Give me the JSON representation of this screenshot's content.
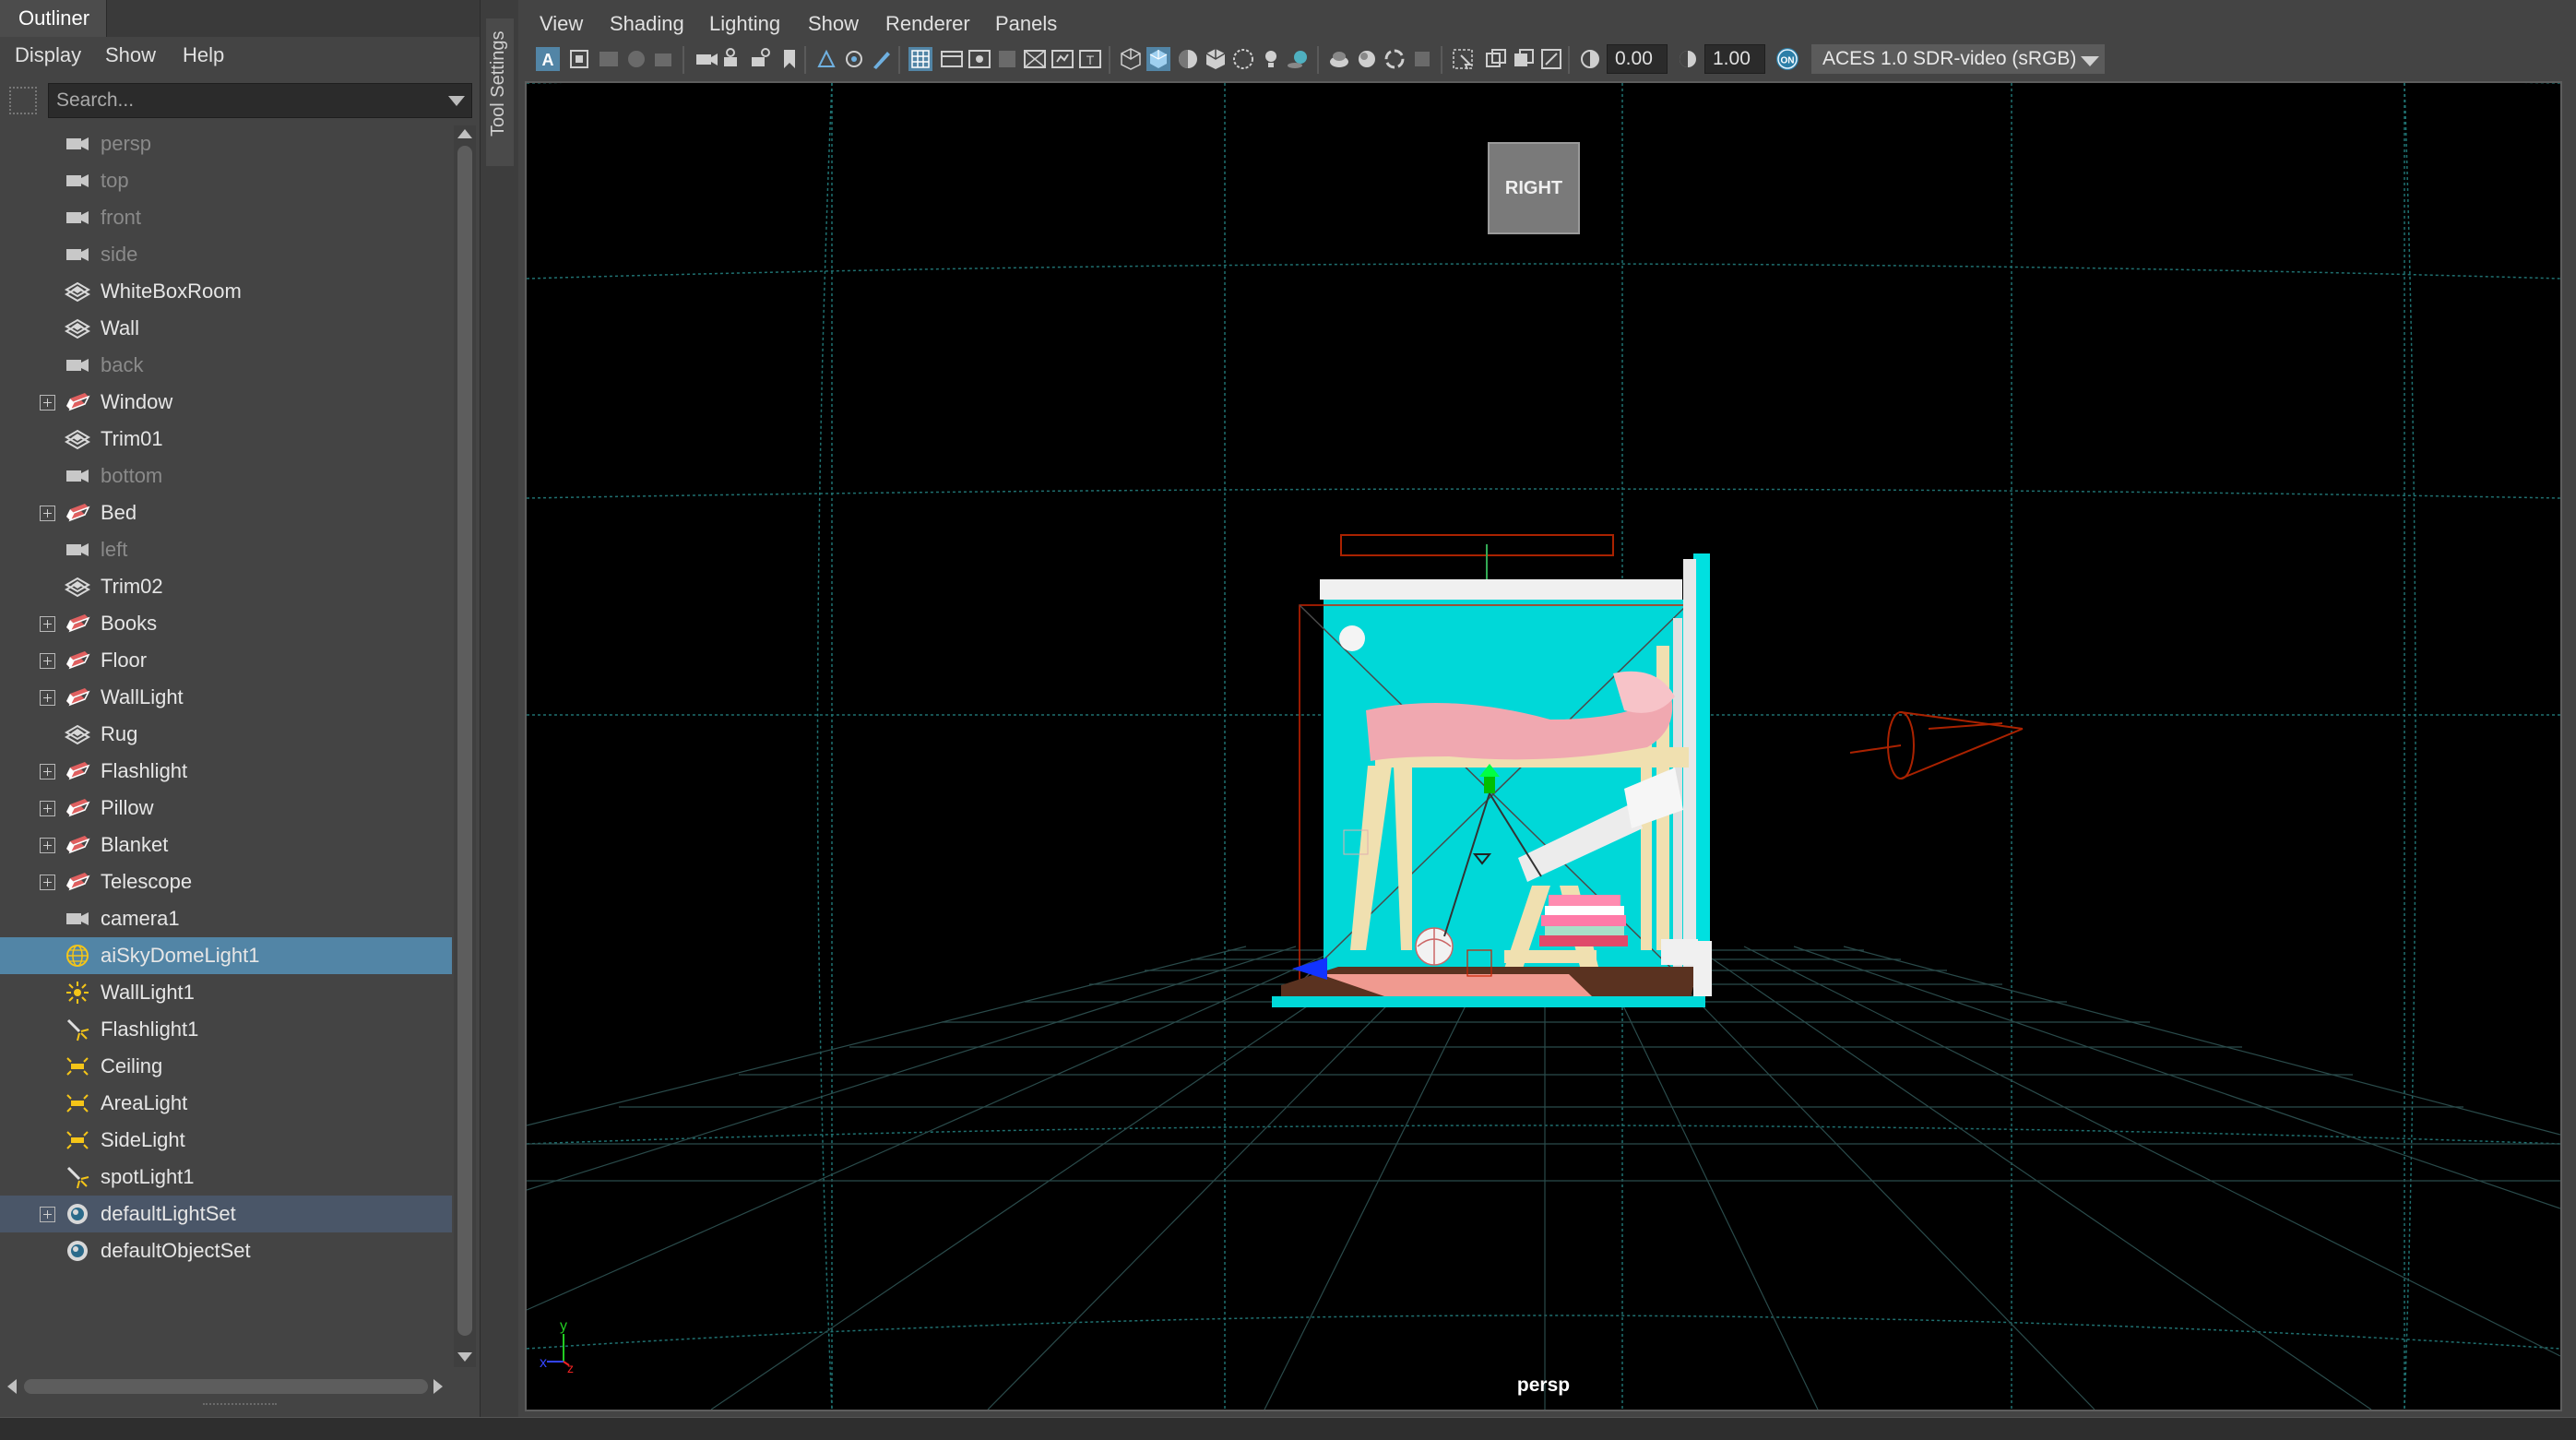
{
  "outliner": {
    "title": "Outliner",
    "menu": [
      "Display",
      "Show",
      "Help"
    ],
    "search_placeholder": "Search...",
    "items": [
      {
        "label": "persp",
        "icon": "camera-icon",
        "dim": true,
        "expandable": false
      },
      {
        "label": "top",
        "icon": "camera-icon",
        "dim": true,
        "expandable": false
      },
      {
        "label": "front",
        "icon": "camera-icon",
        "dim": true,
        "expandable": false
      },
      {
        "label": "side",
        "icon": "camera-icon",
        "dim": true,
        "expandable": false
      },
      {
        "label": "WhiteBoxRoom",
        "icon": "mesh-icon",
        "dim": false,
        "expandable": false
      },
      {
        "label": "Wall",
        "icon": "mesh-icon",
        "dim": false,
        "expandable": false
      },
      {
        "label": "back",
        "icon": "camera-icon",
        "dim": true,
        "expandable": false
      },
      {
        "label": "Window",
        "icon": "group-icon",
        "dim": false,
        "expandable": true
      },
      {
        "label": "Trim01",
        "icon": "mesh-icon",
        "dim": false,
        "expandable": false
      },
      {
        "label": "bottom",
        "icon": "camera-icon",
        "dim": true,
        "expandable": false
      },
      {
        "label": "Bed",
        "icon": "group-icon",
        "dim": false,
        "expandable": true
      },
      {
        "label": "left",
        "icon": "camera-icon",
        "dim": true,
        "expandable": false
      },
      {
        "label": "Trim02",
        "icon": "mesh-icon",
        "dim": false,
        "expandable": false
      },
      {
        "label": "Books",
        "icon": "group-icon",
        "dim": false,
        "expandable": true
      },
      {
        "label": "Floor",
        "icon": "group-icon",
        "dim": false,
        "expandable": true
      },
      {
        "label": "WallLight",
        "icon": "group-icon",
        "dim": false,
        "expandable": true
      },
      {
        "label": "Rug",
        "icon": "mesh-icon",
        "dim": false,
        "expandable": false
      },
      {
        "label": "Flashlight",
        "icon": "group-icon",
        "dim": false,
        "expandable": true
      },
      {
        "label": "Pillow",
        "icon": "group-icon",
        "dim": false,
        "expandable": true
      },
      {
        "label": "Blanket",
        "icon": "group-icon",
        "dim": false,
        "expandable": true
      },
      {
        "label": "Telescope",
        "icon": "group-icon",
        "dim": false,
        "expandable": true
      },
      {
        "label": "camera1",
        "icon": "camera-icon",
        "dim": false,
        "expandable": false
      },
      {
        "label": "aiSkyDomeLight1",
        "icon": "skydome-light-icon",
        "dim": false,
        "expandable": false,
        "selected": true
      },
      {
        "label": "WallLight1",
        "icon": "point-light-icon",
        "dim": false,
        "expandable": false
      },
      {
        "label": "Flashlight1",
        "icon": "spot-light-icon",
        "dim": false,
        "expandable": false
      },
      {
        "label": "Ceiling",
        "icon": "area-light-icon",
        "dim": false,
        "expandable": false
      },
      {
        "label": "AreaLight",
        "icon": "area-light-icon",
        "dim": false,
        "expandable": false
      },
      {
        "label": "SideLight",
        "icon": "area-light-icon",
        "dim": false,
        "expandable": false
      },
      {
        "label": "spotLight1",
        "icon": "spot-light-icon",
        "dim": false,
        "expandable": false
      },
      {
        "label": "defaultLightSet",
        "icon": "set-icon",
        "dim": false,
        "expandable": true,
        "highlight": true
      },
      {
        "label": "defaultObjectSet",
        "icon": "set-icon",
        "dim": false,
        "expandable": false
      }
    ]
  },
  "tool_settings": {
    "label": "Tool Settings"
  },
  "viewport": {
    "menu": [
      "View",
      "Shading",
      "Lighting",
      "Show",
      "Renderer",
      "Panels"
    ],
    "exposure": "0.00",
    "gamma": "1.00",
    "colorspace_toggle": "ON",
    "colorspace": "ACES 1.0 SDR-video (sRGB)",
    "viewcube_label": "RIGHT",
    "camera_label": "persp",
    "axis_labels": {
      "y": "y",
      "x": "x",
      "z": "z"
    }
  },
  "colors": {
    "selection": "#5285a6",
    "wall_cyan": "#00d8d8",
    "blanket_pink": "#f0a8b0",
    "wood": "#f0e0b0",
    "light_outline": "#cc2200",
    "grid": "#1f5050"
  }
}
